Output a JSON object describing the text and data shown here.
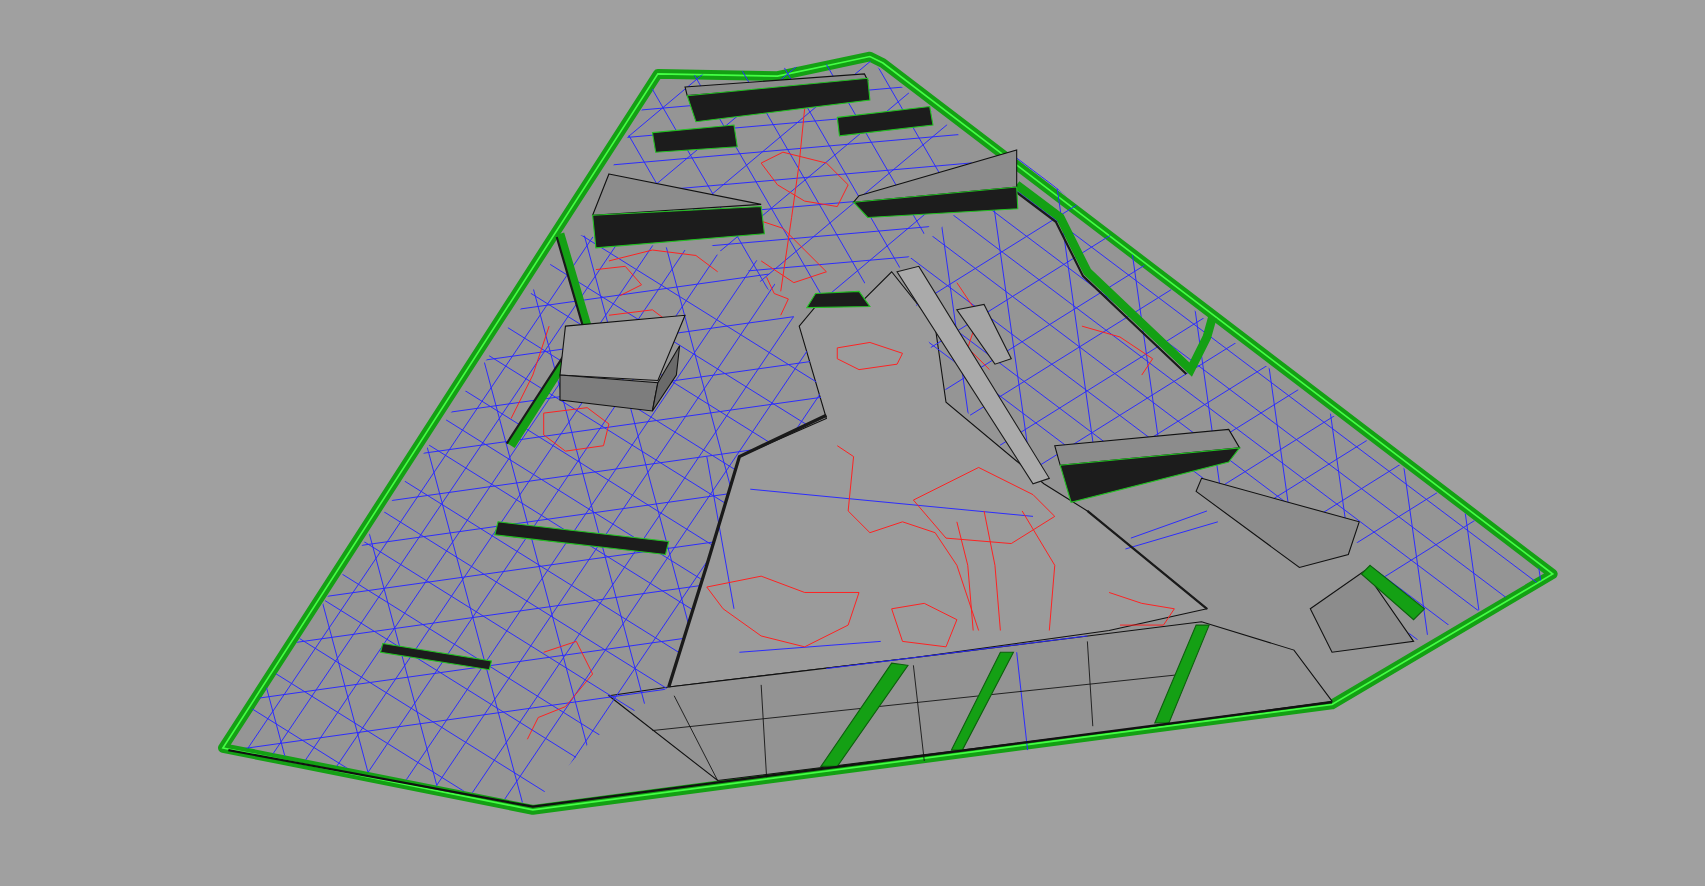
{
  "scene": {
    "kind": "site-model"
  }
}
